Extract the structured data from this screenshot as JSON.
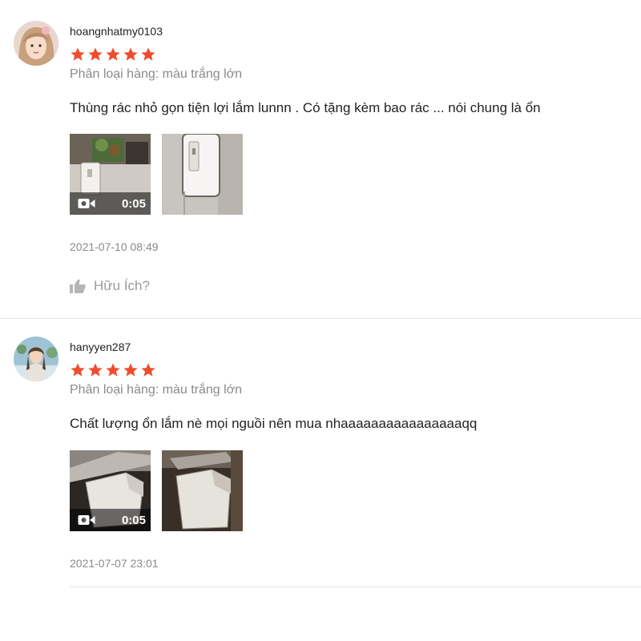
{
  "reviews": [
    {
      "username": "hoangnhatmy0103",
      "rating": 5,
      "variation": "Phân loại hàng: màu trắng lớn",
      "comment": "Thùng rác nhỏ gọn tiện lợi lắm lunnn . Có tặng kèm bao rác ... nói chung là ổn",
      "media": [
        {
          "type": "video",
          "duration": "0:05"
        },
        {
          "type": "image"
        }
      ],
      "timestamp": "2021-07-10 08:49",
      "helpful_label": "Hữu Ích?"
    },
    {
      "username": "hanyyen287",
      "rating": 5,
      "variation": "Phân loại hàng: màu trắng lớn",
      "comment": "Chất lượng ổn lắm nè mọi nguồi nên mua nhaaaaaaaaaaaaaaaaqq",
      "media": [
        {
          "type": "video",
          "duration": "0:05"
        },
        {
          "type": "image"
        }
      ],
      "timestamp": "2021-07-07 23:01"
    }
  ],
  "colors": {
    "star": "#ee4d2d",
    "muted_text": "#8a8a8a",
    "divider": "#e5e5e5"
  },
  "icons": {
    "rating": "star-icon",
    "video": "video-camera-icon",
    "helpful": "thumb-up-icon"
  }
}
